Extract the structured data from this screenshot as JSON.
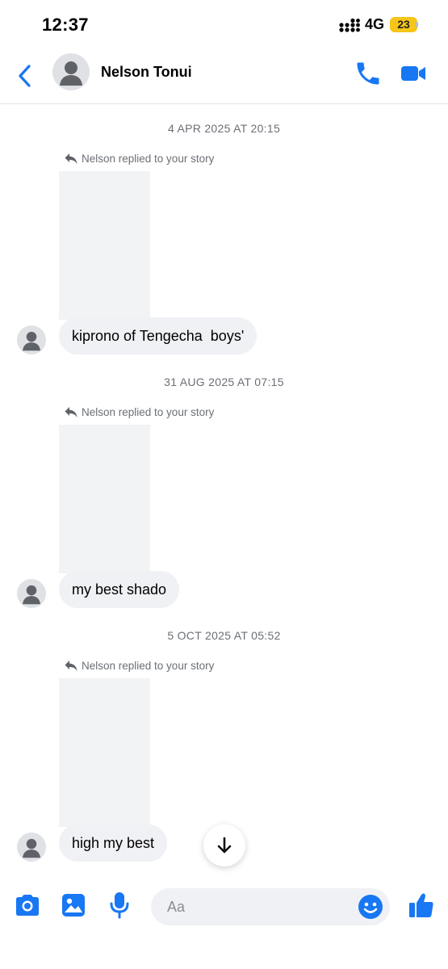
{
  "status": {
    "time": "12:37",
    "network": "4G",
    "battery": "23"
  },
  "header": {
    "name": "Nelson Tonui"
  },
  "messages": [
    {
      "timestamp": "4 APR 2025 AT 20:15",
      "reply_note": "Nelson replied to your story",
      "text": "kiprono of Tengecha  boys'"
    },
    {
      "timestamp": "31 AUG 2025 AT 07:15",
      "reply_note": "Nelson replied to your story",
      "text": "my best shado"
    },
    {
      "timestamp": "5 OCT 2025 AT 05:52",
      "reply_note": "Nelson replied to your story",
      "text": "high my best"
    }
  ],
  "composer": {
    "placeholder": "Aa"
  },
  "colors": {
    "accent": "#1877f2",
    "bubble": "#f0f1f4",
    "story_placeholder": "#f2f3f5",
    "battery": "#f5c518"
  },
  "icons": [
    "back-icon",
    "phone-icon",
    "video-camera-icon",
    "reply-arrow-icon",
    "arrow-down-icon",
    "camera-icon",
    "image-icon",
    "microphone-icon",
    "smiley-icon",
    "thumbs-up-icon"
  ]
}
